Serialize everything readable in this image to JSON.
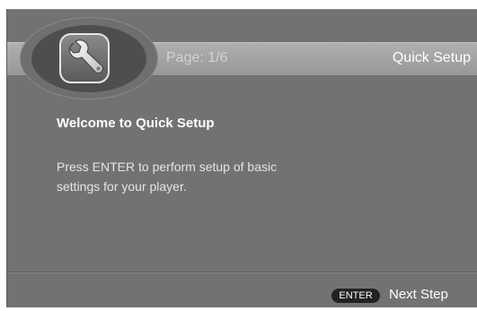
{
  "header": {
    "page_label": "Page: 1/6",
    "section_title": "Quick Setup",
    "icon": "wrench-icon"
  },
  "main": {
    "title": "Welcome to Quick Setup",
    "description": "Press ENTER to perform setup of basic settings for your player."
  },
  "footer": {
    "key_label": "ENTER",
    "action_label": "Next Step"
  },
  "colors": {
    "background": "#727272",
    "header_bar": "#a3a3a3",
    "text_primary": "#ffffff",
    "key_background": "#222222"
  }
}
